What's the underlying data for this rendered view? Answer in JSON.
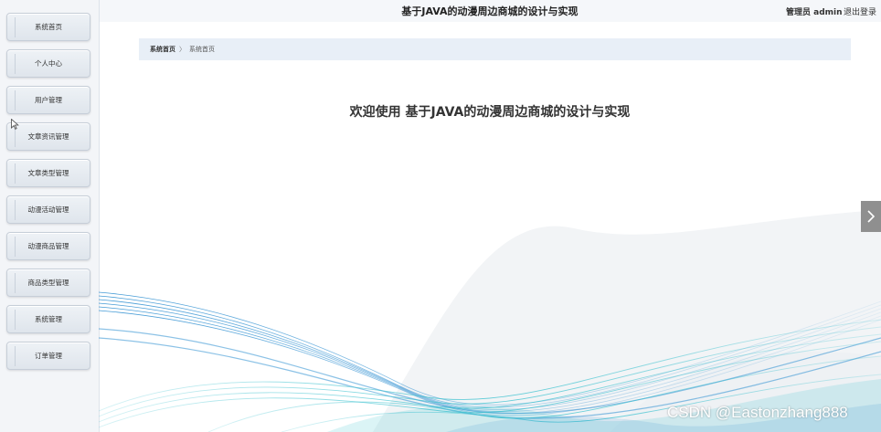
{
  "header": {
    "title": "基于JAVA的动漫周边商城的设计与实现",
    "admin_label": "管理员 admin",
    "logout": "退出登录"
  },
  "sidebar": {
    "items": [
      {
        "label": "系统首页"
      },
      {
        "label": "个人中心"
      },
      {
        "label": "用户管理"
      },
      {
        "label": "文章资讯管理"
      },
      {
        "label": "文章类型管理"
      },
      {
        "label": "动漫活动管理"
      },
      {
        "label": "动漫商品管理"
      },
      {
        "label": "商品类型管理"
      },
      {
        "label": "系统管理"
      },
      {
        "label": "订单管理"
      }
    ]
  },
  "breadcrumb": {
    "home": "系统首页",
    "separator": "〉",
    "current": "系统首页"
  },
  "main": {
    "welcome": "欢迎使用 基于JAVA的动漫周边商城的设计与实现"
  },
  "watermark": "CSDN @Eastonzhang888",
  "icons": {
    "next": "chevron-right-icon",
    "cursor": "mouse-pointer-icon"
  },
  "colors": {
    "wave_primary": "#2e8fd1",
    "wave_secondary": "#39c1cf"
  }
}
